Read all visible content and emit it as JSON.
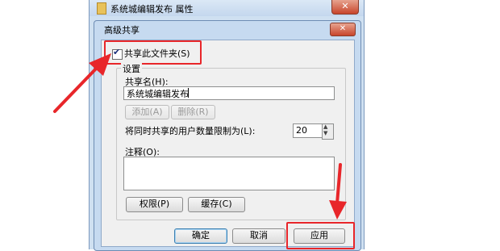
{
  "outer_window": {
    "title": "系统城编辑发布 属性",
    "close_label": "✕"
  },
  "dialog": {
    "title": "高级共享",
    "close_label": "✕"
  },
  "share_checkbox": {
    "label": "共享此文件夹(S)",
    "checked": true,
    "mark": "✔"
  },
  "settings": {
    "legend": "设置",
    "share_name_label": "共享名(H):",
    "share_name_value": "系统城编辑发布",
    "add_label": "添加(A)",
    "remove_label": "删除(R)",
    "limit_label": "将同时共享的用户数量限制为(L):",
    "limit_value": "20",
    "spin_up": "▲",
    "spin_down": "▼",
    "comment_label": "注释(O):",
    "comment_value": "",
    "permissions_label": "权限(P)",
    "caching_label": "缓存(C)"
  },
  "footer": {
    "ok_label": "确定",
    "cancel_label": "取消",
    "apply_label": "应用"
  },
  "annotation_color": "#e8262a"
}
